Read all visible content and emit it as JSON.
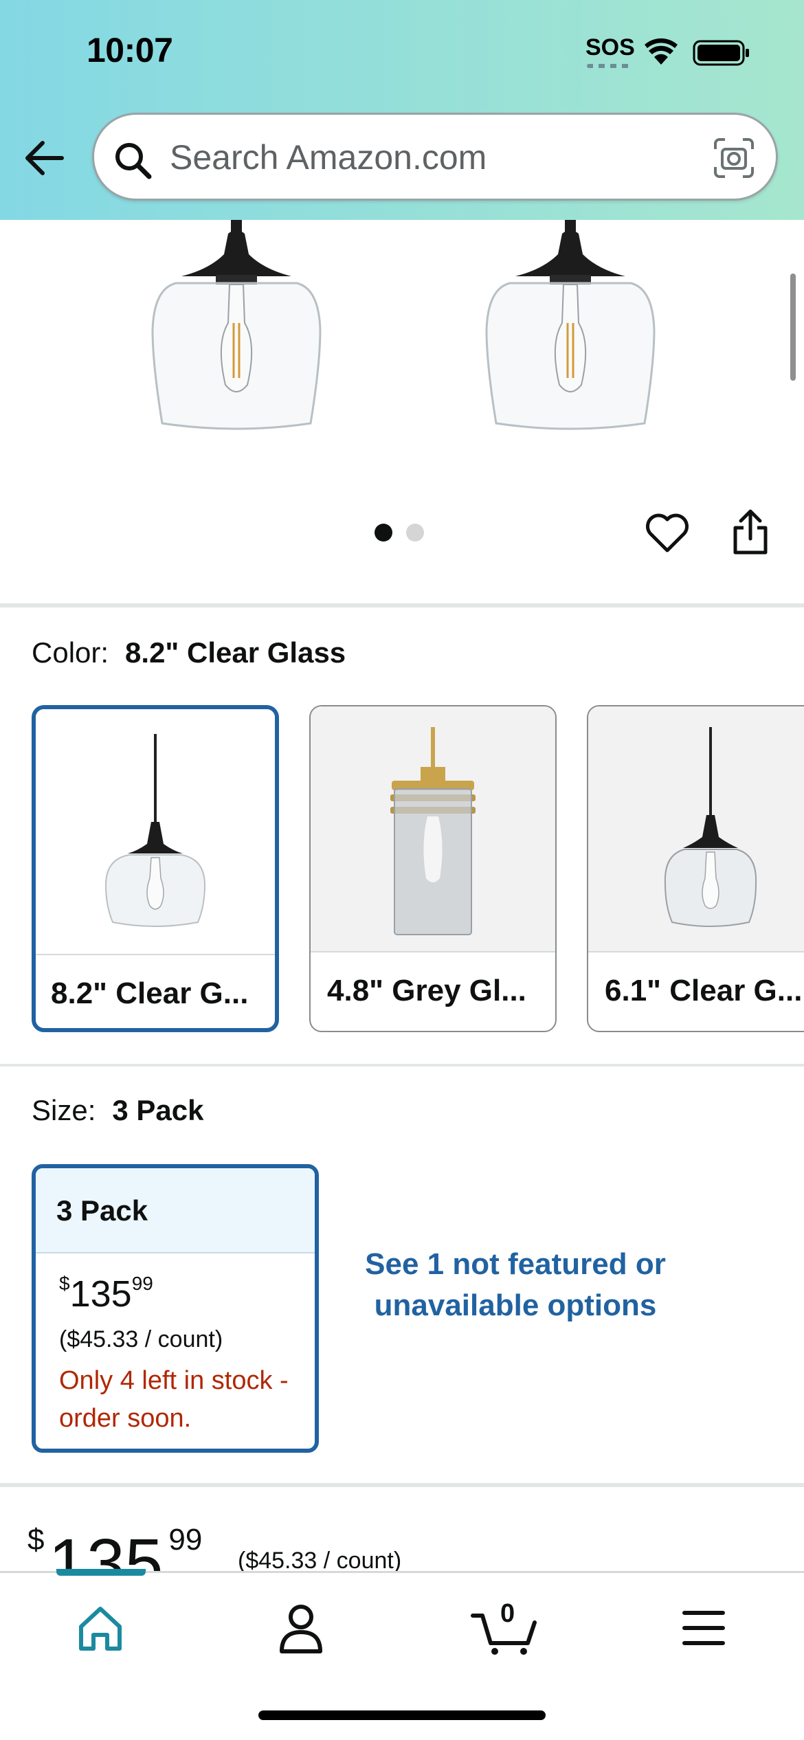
{
  "status_bar": {
    "time": "10:07",
    "sos": "SOS",
    "icons": [
      "wifi-icon",
      "battery-icon"
    ]
  },
  "header": {
    "back_icon": "back-arrow-icon",
    "search_placeholder": "Search Amazon.com",
    "search_icon": "search-icon",
    "camera_icon": "camera-icon"
  },
  "gallery": {
    "image_count": 2,
    "active_index": 0,
    "actions": [
      "heart-icon",
      "share-icon"
    ]
  },
  "color": {
    "label": "Color:",
    "value": "8.2\" Clear Glass",
    "options": [
      {
        "label": "8.2\" Clear G..."
      },
      {
        "label": "4.8\" Grey Gl..."
      },
      {
        "label": "6.1\" Clear G..."
      }
    ]
  },
  "size": {
    "label": "Size:",
    "value": "3 Pack",
    "option": {
      "title": "3 Pack",
      "currency": "$",
      "price_whole": "135",
      "price_cents": "99",
      "per_count": "($45.33 / count)",
      "stock": "Only 4 left in stock - order soon."
    },
    "see_more": "See 1 not featured or unavailable options"
  },
  "price": {
    "currency": "$",
    "whole": "135",
    "cents": "99",
    "per_count": "($45.33 / count)"
  },
  "bottom_nav": {
    "items": [
      "home-icon",
      "account-icon",
      "cart-icon",
      "menu-icon"
    ],
    "cart_count": "0"
  },
  "colors": {
    "accent_blue": "#2162a1",
    "stock_red": "#b12704",
    "nav_teal": "#1b8aa0"
  }
}
